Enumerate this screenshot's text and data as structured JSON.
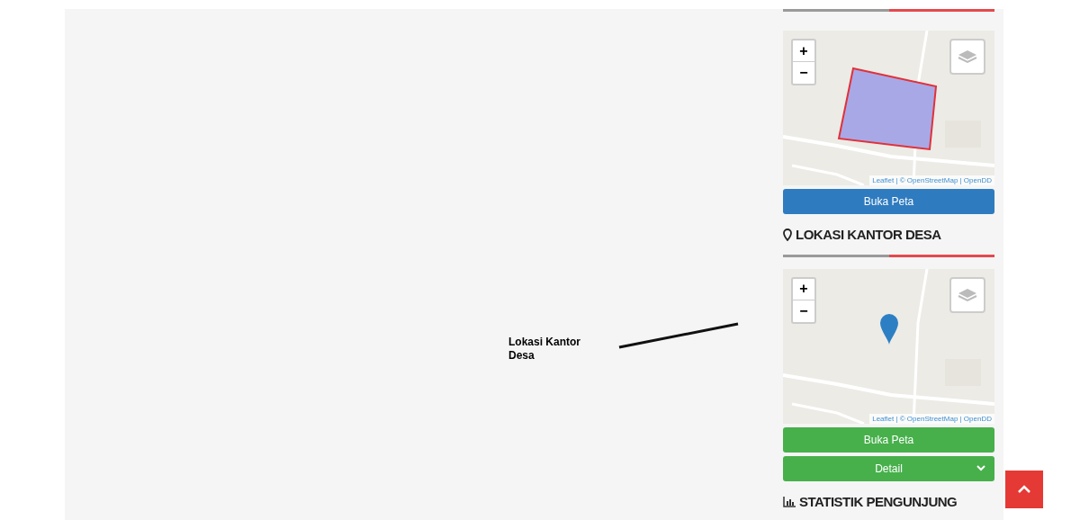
{
  "annotation": {
    "label": "Lokasi Kantor Desa"
  },
  "widgets": [
    {
      "kind": "area-map",
      "zoom_in": "+",
      "zoom_out": "−",
      "attribution": "Leaflet | © OpenStreetMap | OpenDD",
      "buttons": [
        {
          "label": "Buka Peta",
          "color": "#2f7bbf"
        }
      ]
    },
    {
      "kind": "location-title",
      "text": "LOKASI KANTOR DESA"
    },
    {
      "kind": "marker-map",
      "zoom_in": "+",
      "zoom_out": "−",
      "attribution": "Leaflet | © OpenStreetMap | OpenDD",
      "buttons": [
        {
          "label": "Buka Peta",
          "color": "#47b04b"
        },
        {
          "label": "Detail",
          "color": "#47b04b",
          "dropdown": true
        }
      ]
    },
    {
      "kind": "stats-title",
      "text": "STATISTIK PENGUNJUNG"
    }
  ]
}
